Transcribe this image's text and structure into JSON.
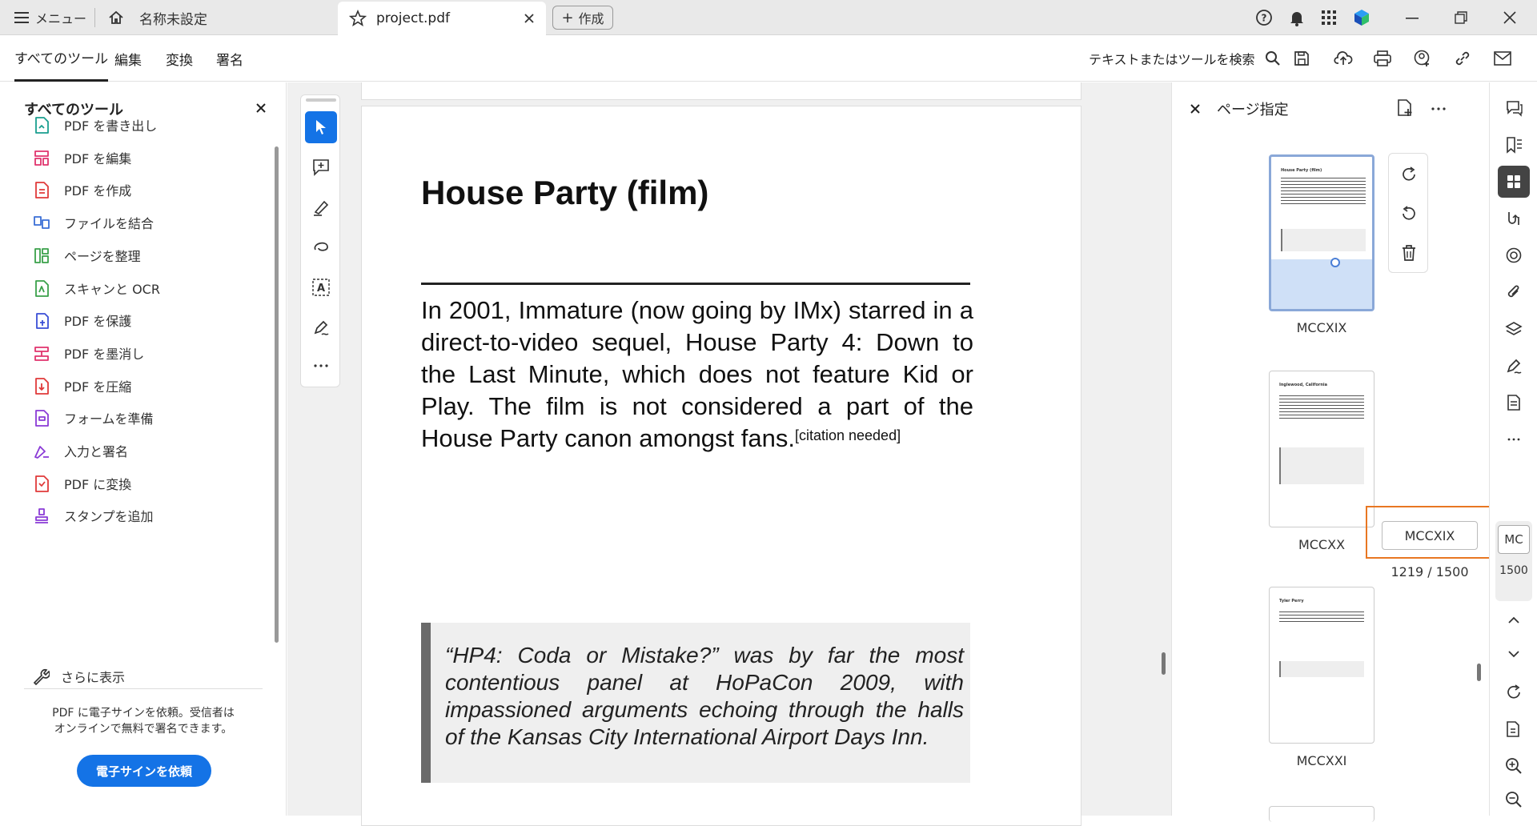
{
  "titlebar": {
    "menu_label": "メニュー",
    "doc_untitled": "名称未設定",
    "active_tab": "project.pdf",
    "create_label": "作成"
  },
  "toolbar": {
    "menus": [
      "すべてのツール",
      "編集",
      "変換",
      "署名"
    ],
    "search_label": "テキストまたはツールを検索"
  },
  "left_panel": {
    "title": "すべてのツール",
    "items": [
      {
        "label": "PDF を書き出し",
        "color": "#1a9e8f"
      },
      {
        "label": "PDF を編集",
        "color": "#e0336d"
      },
      {
        "label": "PDF を作成",
        "color": "#e03a3a"
      },
      {
        "label": "ファイルを結合",
        "color": "#3a6fd6"
      },
      {
        "label": "ページを整理",
        "color": "#3aa14a"
      },
      {
        "label": "スキャンと OCR",
        "color": "#3aa14a"
      },
      {
        "label": "PDF を保護",
        "color": "#3a4fd6"
      },
      {
        "label": "PDF を墨消し",
        "color": "#e0336d"
      },
      {
        "label": "PDF を圧縮",
        "color": "#e03a3a"
      },
      {
        "label": "フォームを準備",
        "color": "#8a3ad6"
      },
      {
        "label": "入力と署名",
        "color": "#8a3ad6"
      },
      {
        "label": "PDF に変換",
        "color": "#e03a3a"
      },
      {
        "label": "スタンプを追加",
        "color": "#8a3ad6"
      }
    ],
    "more_label": "さらに表示",
    "promo_line1": "PDF に電子サインを依頼。受信者は",
    "promo_line2": "オンラインで無料で署名できます。",
    "promo_button": "電子サインを依頼"
  },
  "document": {
    "title": "House Party (film)",
    "body": "In 2001, Immature (now going by IMx) starred in a direct-to-video sequel, House Party 4: Down to the Last Minute, which does not feature Kid or Play. The film is not considered a part of the House Party canon amongst fans.",
    "citation": "[citation needed]",
    "quote": "“HP4: Coda or Mistake?” was by far the most contentious panel at HoPaCon 2009, with impassioned arguments echoing through the halls of the Kansas City International Airport Days Inn."
  },
  "right_panel": {
    "title": "ページ指定",
    "thumbnails": [
      {
        "label": "MCCXIX",
        "thumb_title": "House Party (film)"
      },
      {
        "label": "MCCXX",
        "thumb_title": "Inglewood, California"
      },
      {
        "label": "MCCXXI",
        "thumb_title": "Tyler Perry"
      }
    ]
  },
  "page_nav": {
    "current_label": "MCCXIX",
    "position": "1219 / 1500",
    "rail_label": "MC",
    "rail_total": "1500"
  },
  "colors": {
    "accent": "#1473e6",
    "highlight": "#e87722"
  }
}
